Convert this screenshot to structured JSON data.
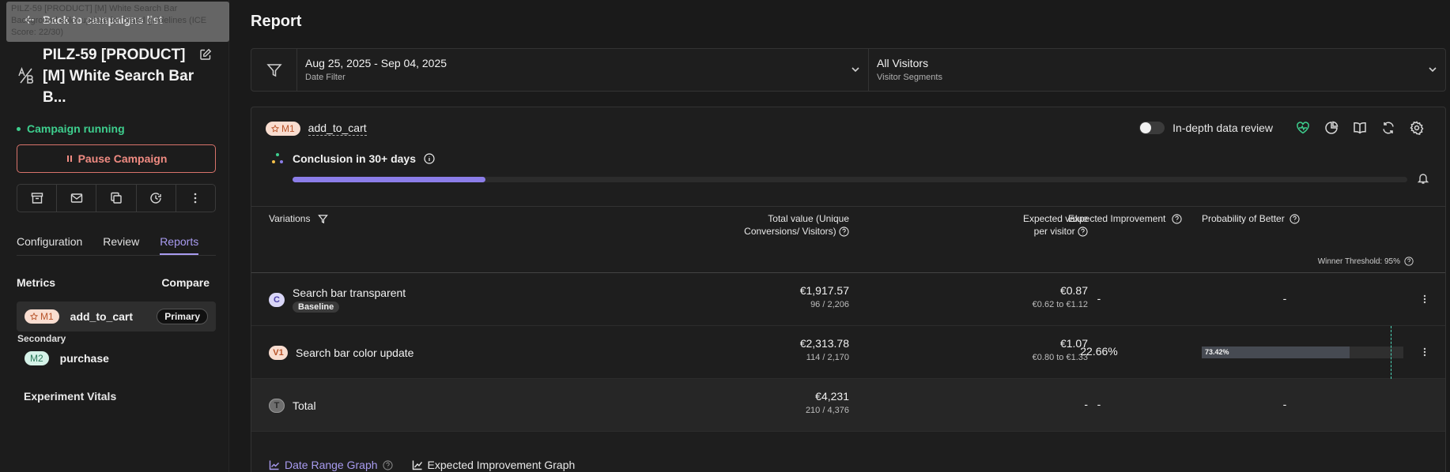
{
  "sidebar": {
    "tooltip": "PILZ-59 [PRODUCT] [M] White Search Bar Background color update for brand guidelines (ICE Score: 22/30)",
    "back_label": "Back to campaigns list",
    "campaign_title": "PILZ-59 [PRODUCT] [M] White Search Bar B...",
    "status": "Campaign running",
    "pause_label": "Pause Campaign",
    "tabs": [
      "Configuration",
      "Review",
      "Reports"
    ],
    "active_tab": "Reports",
    "metrics_label": "Metrics",
    "compare_label": "Compare",
    "primary_metric": {
      "badge": "M1",
      "name": "add_to_cart",
      "tag": "Primary"
    },
    "secondary_label": "Secondary",
    "secondary_metric": {
      "badge": "M2",
      "name": "purchase"
    },
    "vitals_label": "Experiment Vitals"
  },
  "main": {
    "title": "Report",
    "date_filter": {
      "value": "Aug 25, 2025 - Sep 04, 2025",
      "label": "Date Filter"
    },
    "segment_filter": {
      "value": "All Visitors",
      "label": "Visitor Segments"
    },
    "goal": {
      "badge": "M1",
      "name": "add_to_cart"
    },
    "depth_label": "In-depth data review",
    "conclusion": "Conclusion in 30+ days",
    "conclusion_progress": 0.173,
    "table": {
      "headers": {
        "variations": "Variations",
        "total_value": "Total value (Unique Conversions/ Visitors)",
        "expected_value": "Expected value per visitor",
        "improvement": "Expected Improvement",
        "probability": "Probability of Better"
      },
      "winner_threshold": "Winner Threshold: 95%",
      "rows": [
        {
          "badge": "C",
          "name": "Search bar transparent",
          "tag": "Baseline",
          "total": "€1,917.57",
          "total_sub": "96 / 2,206",
          "expected": "€0.87",
          "expected_sub": "€0.62 to €1.12",
          "improvement": "-",
          "probability": "-"
        },
        {
          "badge": "V1",
          "name": "Search bar color update",
          "total": "€2,313.78",
          "total_sub": "114 / 2,170",
          "expected": "€1.07",
          "expected_sub": "€0.80 to €1.33",
          "improvement": "22.66%",
          "probability": "73.42%",
          "probability_value": 0.7342
        }
      ],
      "total_row": {
        "badge": "T",
        "name": "Total",
        "total": "€4,231",
        "total_sub": "210 / 4,376",
        "expected": "-",
        "improvement": "-",
        "probability": "-"
      }
    },
    "graph_links": [
      "Date Range Graph",
      "Expected Improvement Graph"
    ]
  },
  "colors": {
    "accent": "#a89bf0",
    "running": "#3ecf8e",
    "pause": "#f08b82",
    "threshold": "#4dd6b8"
  }
}
